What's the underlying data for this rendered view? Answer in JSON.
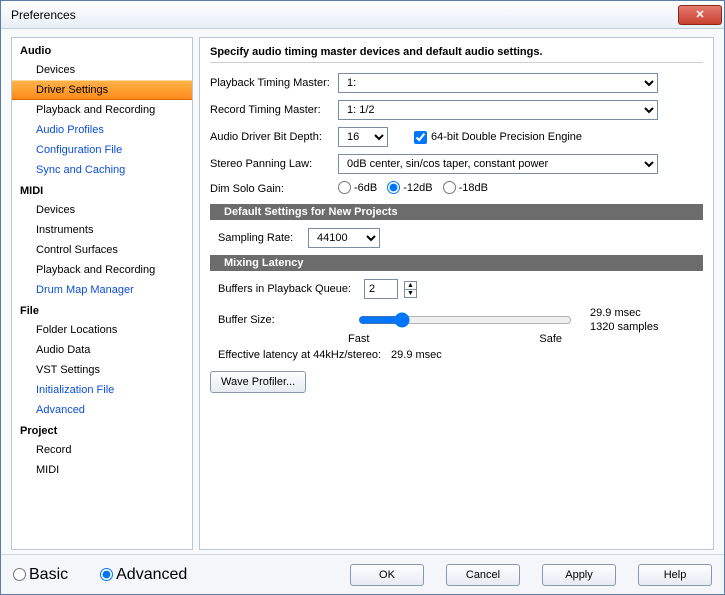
{
  "window": {
    "title": "Preferences"
  },
  "sidebar": {
    "cats": [
      {
        "label": "Audio",
        "items": [
          {
            "label": "Devices",
            "link": false
          },
          {
            "label": "Driver Settings",
            "link": false,
            "selected": true
          },
          {
            "label": "Playback and Recording",
            "link": false
          },
          {
            "label": "Audio Profiles",
            "link": true
          },
          {
            "label": "Configuration File",
            "link": true
          },
          {
            "label": "Sync and Caching",
            "link": true
          }
        ]
      },
      {
        "label": "MIDI",
        "items": [
          {
            "label": "Devices",
            "link": false
          },
          {
            "label": "Instruments",
            "link": false
          },
          {
            "label": "Control Surfaces",
            "link": false
          },
          {
            "label": "Playback and Recording",
            "link": false
          },
          {
            "label": "Drum Map Manager",
            "link": true
          }
        ]
      },
      {
        "label": "File",
        "items": [
          {
            "label": "Folder Locations",
            "link": false
          },
          {
            "label": "Audio Data",
            "link": false
          },
          {
            "label": "VST Settings",
            "link": false
          },
          {
            "label": "Initialization File",
            "link": true
          },
          {
            "label": "Advanced",
            "link": true
          }
        ]
      },
      {
        "label": "Project",
        "items": [
          {
            "label": "Record",
            "link": false
          },
          {
            "label": "MIDI",
            "link": false
          }
        ]
      }
    ]
  },
  "main": {
    "heading": "Specify audio timing master devices and default audio settings.",
    "playbackMasterLabel": "Playback Timing Master:",
    "playbackMasterValue": "1:",
    "recordMasterLabel": "Record Timing Master:",
    "recordMasterValue": "1:  1/2",
    "bitDepthLabel": "Audio Driver Bit Depth:",
    "bitDepthValue": "16",
    "precisionLabel": "64-bit Double Precision Engine",
    "panningLabel": "Stereo Panning Law:",
    "panningValue": "0dB center, sin/cos taper, constant power",
    "dimSoloLabel": "Dim Solo Gain:",
    "dimOptions": [
      "-6dB",
      "-12dB",
      "-18dB"
    ],
    "dimSelected": 1,
    "defaultsHeader": "Default Settings for New Projects",
    "samplingLabel": "Sampling Rate:",
    "samplingValue": "44100",
    "latencyHeader": "Mixing Latency",
    "buffersLabel": "Buffers in Playback Queue:",
    "buffersValue": "2",
    "bufferSizeLabel": "Buffer Size:",
    "sliderFast": "Fast",
    "sliderSafe": "Safe",
    "latencyMs": "29.9 msec",
    "latencySamples": "1320 samples",
    "effectiveLabel": "Effective latency at 44kHz/stereo:",
    "effectiveValue": "29.9 msec",
    "waveProfiler": "Wave Profiler..."
  },
  "footer": {
    "basic": "Basic",
    "advanced": "Advanced",
    "ok": "OK",
    "cancel": "Cancel",
    "apply": "Apply",
    "help": "Help"
  }
}
